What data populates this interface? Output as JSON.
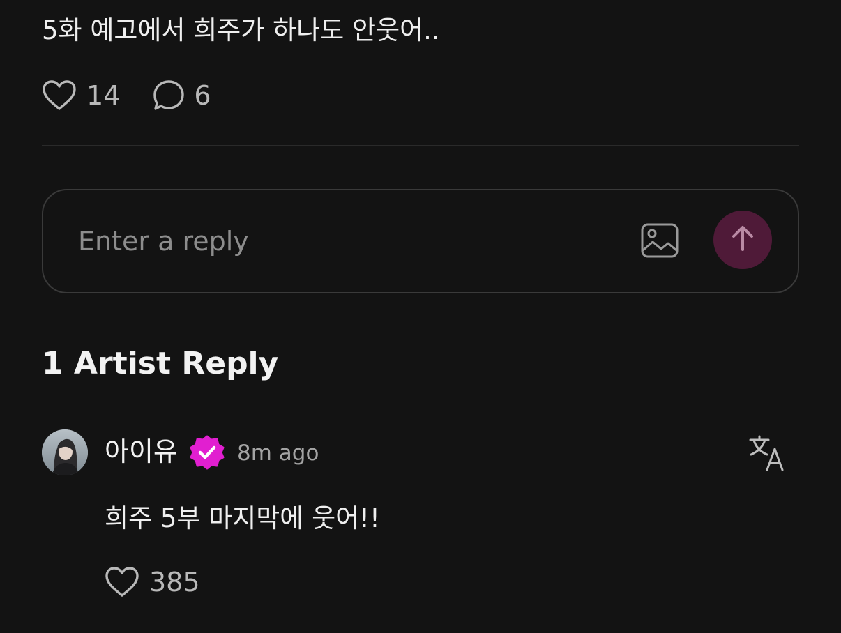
{
  "post": {
    "text": "5화 예고에서 희주가 하나도 안웃어..",
    "likes": "14",
    "comments": "6"
  },
  "reply_box": {
    "placeholder": "Enter a reply",
    "image_icon": "image-icon",
    "send_icon": "arrow-up-icon"
  },
  "artist_replies": {
    "title": "1 Artist Reply",
    "items": [
      {
        "author": "아이유",
        "verified": true,
        "time": "8m ago",
        "text": "희주 5부 마지막에 웃어!!",
        "likes": "385"
      }
    ]
  },
  "colors": {
    "background": "#131313",
    "send_button": "#4f1a38",
    "verified_badge": "#e11fd0",
    "secondary_text": "#a3a3a3"
  }
}
